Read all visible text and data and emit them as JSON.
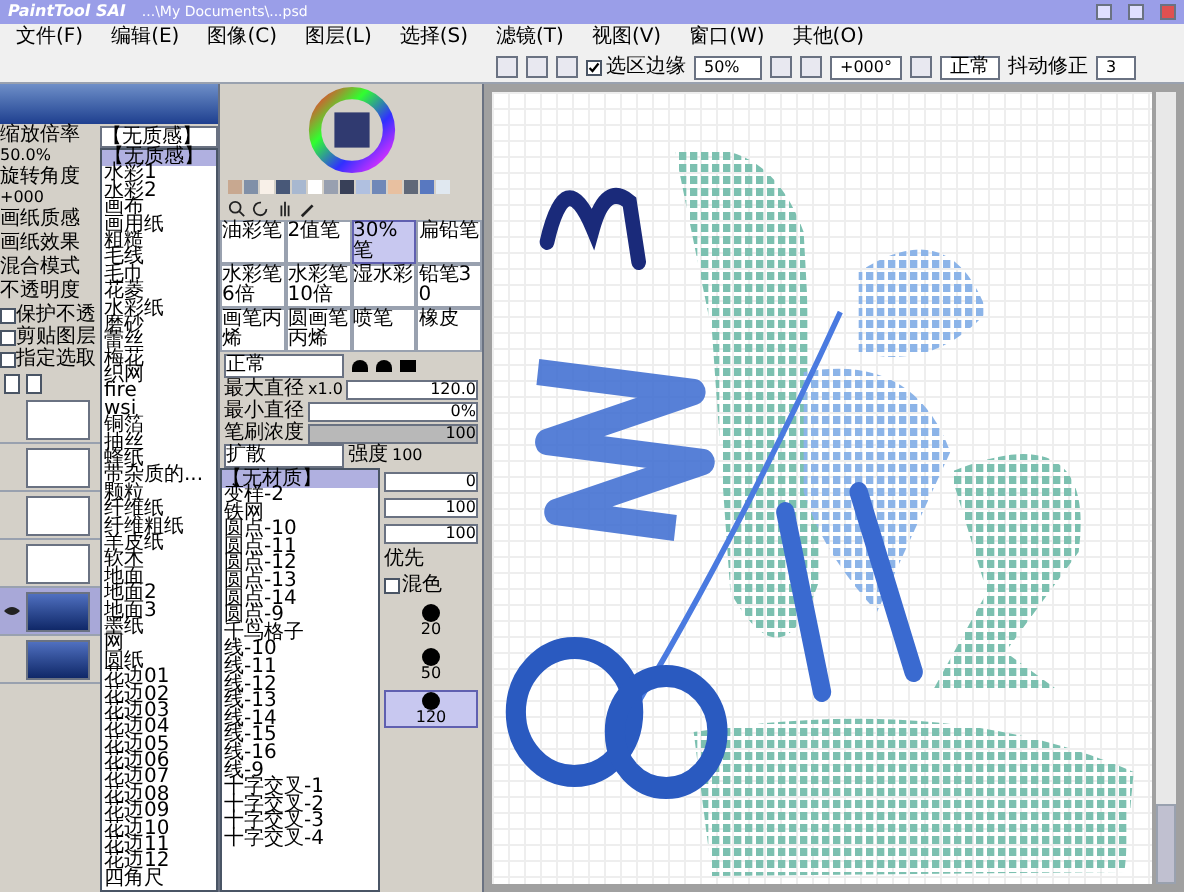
{
  "title_bar": {
    "logo": "PaintTool SAI",
    "title": "...\\My Documents\\...psd"
  },
  "menu": [
    "文件(F)",
    "编辑(E)",
    "图像(C)",
    "图层(L)",
    "选择(S)",
    "滤镜(T)",
    "视图(V)",
    "窗口(W)",
    "其他(O)"
  ],
  "toolbar": {
    "selection_edge": {
      "label": "选区边缘",
      "checked": true
    },
    "zoom": "50%",
    "angle": "+000°",
    "blend": "正常",
    "stabilizer_label": "抖动修正",
    "stabilizer": "3"
  },
  "navigator": {
    "zoom_label": "缩放倍率",
    "zoom": "50.0%",
    "angle_label": "旋转角度",
    "angle": "+000"
  },
  "layer_panel": {
    "paper_texture_label": "画纸质感",
    "paper_texture": "【无质感】",
    "labels": [
      "画纸效果",
      "混合模式",
      "不透明度"
    ],
    "options": [
      {
        "label": "保护不透",
        "checked": false
      },
      {
        "label": "剪贴图层",
        "checked": false
      },
      {
        "label": "指定选取",
        "checked": false
      }
    ],
    "layers": [
      {
        "kind": "blank",
        "selected": false
      },
      {
        "kind": "blank",
        "selected": false
      },
      {
        "kind": "blank",
        "selected": false
      },
      {
        "kind": "blank",
        "selected": false
      },
      {
        "kind": "blue",
        "selected": true
      },
      {
        "kind": "blue",
        "selected": false
      }
    ]
  },
  "texture_list": [
    {
      "label": "【无质感】",
      "selected": true
    },
    {
      "label": "水彩1",
      "selected": false
    },
    {
      "label": "水彩2",
      "selected": false
    },
    {
      "label": "画布",
      "selected": false
    },
    {
      "label": "画用纸",
      "selected": false
    },
    {
      "label": "粗糙",
      "selected": false
    },
    {
      "label": "毛线",
      "selected": false
    },
    {
      "label": "毛巾",
      "selected": false
    },
    {
      "label": "花菱",
      "selected": false
    },
    {
      "label": "水彩纸",
      "selected": false
    },
    {
      "label": "磨砂",
      "selected": false
    },
    {
      "label": "蕾丝",
      "selected": false
    },
    {
      "label": "梅花",
      "selected": false
    },
    {
      "label": "织网",
      "selected": false
    },
    {
      "label": "fire",
      "selected": false
    },
    {
      "label": "wsi",
      "selected": false
    },
    {
      "label": "铜箔",
      "selected": false
    },
    {
      "label": "抽丝",
      "selected": false
    },
    {
      "label": "蜂纸",
      "selected": false
    },
    {
      "label": "带杂质的...",
      "selected": false
    },
    {
      "label": "颗粒",
      "selected": false
    },
    {
      "label": "纤维纸",
      "selected": false
    },
    {
      "label": "纤维粗纸",
      "selected": false
    },
    {
      "label": "羊皮纸",
      "selected": false
    },
    {
      "label": "软木",
      "selected": false
    },
    {
      "label": "地面",
      "selected": false
    },
    {
      "label": "地面2",
      "selected": false
    },
    {
      "label": "地面3",
      "selected": false
    },
    {
      "label": "墨纸",
      "selected": false
    },
    {
      "label": "网",
      "selected": false
    },
    {
      "label": "圆纸",
      "selected": false
    },
    {
      "label": "花边01",
      "selected": false
    },
    {
      "label": "花边02",
      "selected": false
    },
    {
      "label": "花边03",
      "selected": false
    },
    {
      "label": "花边04",
      "selected": false
    },
    {
      "label": "花边05",
      "selected": false
    },
    {
      "label": "花边06",
      "selected": false
    },
    {
      "label": "花边07",
      "selected": false
    },
    {
      "label": "花边08",
      "selected": false
    },
    {
      "label": "花边09",
      "selected": false
    },
    {
      "label": "花边10",
      "selected": false
    },
    {
      "label": "花边11",
      "selected": false
    },
    {
      "label": "花边12",
      "selected": false
    },
    {
      "label": "四角尺",
      "selected": false
    }
  ],
  "swatches": [
    {
      "color": "#c8a890"
    },
    {
      "color": "#8090a8"
    },
    {
      "color": "#f8f0e8"
    },
    {
      "color": "#485878"
    },
    {
      "color": "#a8b8d0"
    },
    {
      "color": "#ffffff"
    },
    {
      "color": "#98a0b0"
    },
    {
      "color": "#384058"
    },
    {
      "color": "#b0c0e0"
    },
    {
      "color": "#7088b8"
    },
    {
      "color": "#e8c0a0"
    },
    {
      "color": "#606878"
    },
    {
      "color": "#5878c0"
    },
    {
      "color": "#e0e8f0"
    }
  ],
  "brushes": [
    {
      "label": "油彩笔",
      "selected": false
    },
    {
      "label": "2值笔",
      "selected": false
    },
    {
      "label": "30%笔",
      "selected": true
    },
    {
      "label": "扁铅笔",
      "selected": false
    },
    {
      "label": "水彩笔6倍",
      "selected": false
    },
    {
      "label": "水彩笔10倍",
      "selected": false
    },
    {
      "label": "湿水彩",
      "selected": false
    },
    {
      "label": "铅笔30",
      "selected": false
    },
    {
      "label": "画笔丙烯",
      "selected": false
    },
    {
      "label": "圆画笔丙烯",
      "selected": false
    },
    {
      "label": "喷笔",
      "selected": false
    },
    {
      "label": "橡皮",
      "selected": false
    }
  ],
  "brush_settings": {
    "mode": "正常",
    "max_size_label": "最大直径",
    "max_size_scale": "x1.0",
    "max_size": "120.0",
    "min_size_label": "最小直径",
    "min_size": "0%",
    "density_label": "笔刷浓度",
    "density": "100",
    "spread": "扩散",
    "strength_label": "强度",
    "strength": "100"
  },
  "material_list": {
    "header": "【无材质】",
    "items": [
      "变样-2",
      "铁网",
      "圆点-10",
      "圆点-11",
      "圆点-12",
      "圆点-13",
      "圆点-14",
      "圆点-9",
      "千鸟格子",
      "线-10",
      "线-11",
      "线-12",
      "线-13",
      "线-14",
      "线-15",
      "线-16",
      "线-9",
      "十字交叉-1",
      "十字交叉-2",
      "十字交叉-3",
      "十字交叉-4"
    ]
  },
  "side_values": [
    "0",
    "100",
    "100"
  ],
  "priority": "优先",
  "mix": {
    "label": "混色",
    "checked": false
  },
  "sizes": [
    {
      "label": "20",
      "selected": false
    },
    {
      "label": "50",
      "selected": false
    },
    {
      "label": "120",
      "selected": true
    }
  ]
}
